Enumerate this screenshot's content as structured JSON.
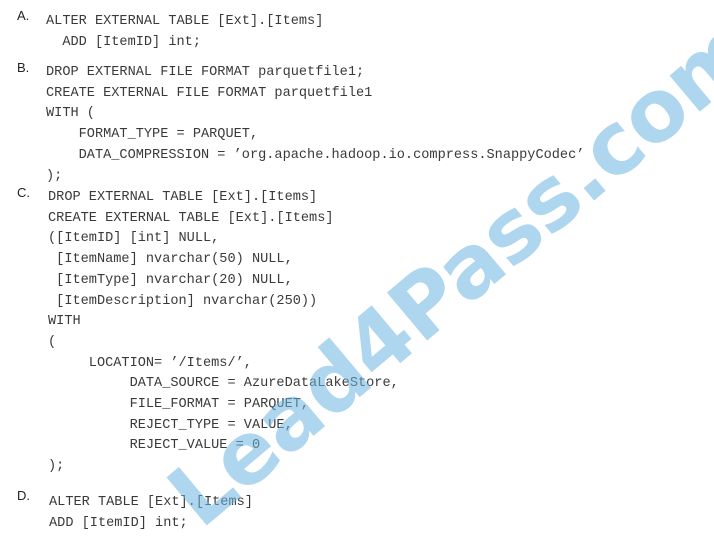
{
  "options": [
    {
      "letter": "A.",
      "code": "ALTER EXTERNAL TABLE [Ext].[Items]\n  ADD [ItemID] int;"
    },
    {
      "letter": "B.",
      "code": "DROP EXTERNAL FILE FORMAT parquetfile1;\nCREATE EXTERNAL FILE FORMAT parquetfile1\nWITH (\n    FORMAT_TYPE = PARQUET,\n    DATA_COMPRESSION = ’org.apache.hadoop.io.compress.SnappyCodec’\n);"
    },
    {
      "letter": "C.",
      "code": "DROP EXTERNAL TABLE [Ext].[Items]\nCREATE EXTERNAL TABLE [Ext].[Items]\n([ItemID] [int] NULL,\n [ItemName] nvarchar(50) NULL,\n [ItemType] nvarchar(20) NULL,\n [ItemDescription] nvarchar(250))\nWITH\n(\n     LOCATION= ’/Items/’,\n          DATA_SOURCE = AzureDataLakeStore,\n          FILE_FORMAT = PARQUET,\n          REJECT_TYPE = VALUE,\n          REJECT_VALUE = 0\n);"
    },
    {
      "letter": "D.",
      "code": "ALTER TABLE [Ext].[Items]\nADD [ItemID] int;"
    }
  ],
  "watermark": {
    "text": "Lead4Pass.com",
    "color": "#6eb4e1"
  }
}
